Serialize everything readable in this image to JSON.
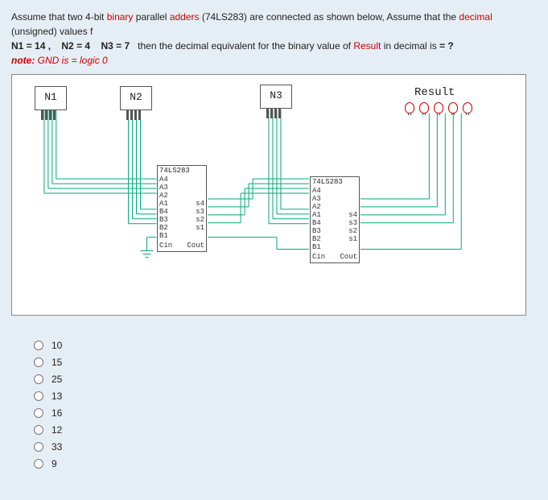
{
  "prompt": {
    "line1_a": "Assume that two 4-bit",
    "binary": "binary",
    "line1_b": "parallel",
    "adders": "adders",
    "line1_c": "(74LS283) are connected as shown below, Assume that the",
    "decimal_word": "decimal",
    "line1_d": "(unsigned) values f",
    "n1lbl": "N1",
    "n1val": "= 14 ,",
    "n2lbl": "N2",
    "n2val": "= 4",
    "n3lbl": "N3",
    "n3val": "= 7",
    "line2_a": "then the decimal equivalent for the binary value of",
    "result_word": "Result",
    "line2_b": "in decimal is",
    "qmark": "= ?",
    "note_a": "note:",
    "note_b": "GND is = logic 0"
  },
  "diagram": {
    "N1": "N1",
    "N2": "N2",
    "N3": "N3",
    "Result": "Result",
    "ic_name": "74LS283",
    "pins_left": [
      "A4",
      "A3",
      "A2",
      "A1",
      "B4",
      "B3",
      "B2",
      "B1"
    ],
    "pins_right": [
      "s4",
      "s3",
      "s2",
      "s1"
    ],
    "cin": "Cin",
    "cout": "Cout"
  },
  "answers": [
    "10",
    "15",
    "25",
    "13",
    "16",
    "12",
    "33",
    "9"
  ]
}
